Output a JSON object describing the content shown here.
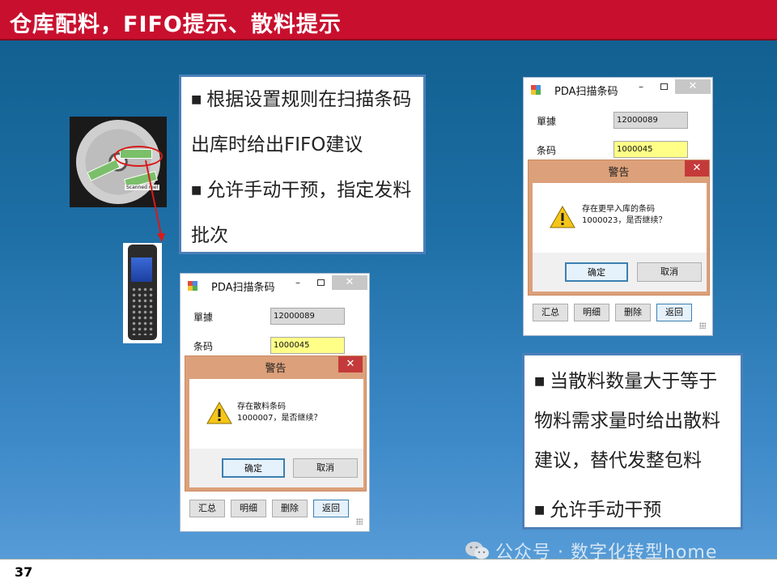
{
  "slide": {
    "title": "仓库配料，FIFO提示、散料提示",
    "page_number": "37",
    "watermark": "公众号 · 数字化转型home"
  },
  "colors": {
    "title_red": "#c8102e",
    "textbox_border": "#4d7fb8",
    "warn_dialog": "#dca07a",
    "input_yellow": "#ffff88"
  },
  "textbox_top": {
    "bullet1": "根据设置规则在扫描条码出库时给出FIFO建议",
    "bullet2": "允许手动干预，指定发料批次"
  },
  "textbox_bottom": {
    "bullet1": "当散料数量大于等于物料需求量时给出散料建议，替代发整包料",
    "bullet2": "允许手动干预"
  },
  "reel_image": {
    "scan_label": "Scanned reel"
  },
  "dialog_left": {
    "window_title": "PDA扫描条码",
    "field1_label": "單據",
    "field1_value": "12000089",
    "field2_label": "条码",
    "field2_value": "1000045",
    "warning_title": "警告",
    "warning_line1": "存在散料条码",
    "warning_line2": "1000007，是否继续？",
    "ok_button": "确定",
    "cancel_button": "取消",
    "btn_summary": "汇总",
    "btn_detail": "明细",
    "btn_delete": "删除",
    "btn_return": "返回",
    "close_glyph": "✕",
    "min_glyph": "–"
  },
  "dialog_right": {
    "window_title": "PDA扫描条码",
    "field1_label": "單據",
    "field1_value": "12000089",
    "field2_label": "条码",
    "field2_value": "1000045",
    "warning_title": "警告",
    "warning_line1": "存在更早入库的条码",
    "warning_line2": "1000023，是否继续？",
    "ok_button": "确定",
    "cancel_button": "取消",
    "btn_summary": "汇总",
    "btn_detail": "明细",
    "btn_delete": "删除",
    "btn_return": "返回",
    "close_glyph": "✕",
    "min_glyph": "–"
  },
  "icons": {
    "bullet": "square-bullet-icon",
    "warning": "warning-triangle-icon",
    "app": "app-window-icon",
    "wechat": "wechat-icon"
  }
}
